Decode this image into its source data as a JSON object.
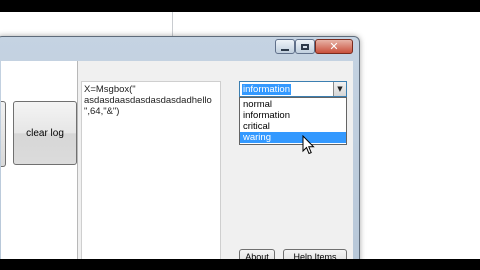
{
  "window": {
    "controls": {
      "minimize_icon": "minimize-icon",
      "maximize_icon": "maximize-icon",
      "close_icon": "close-icon",
      "close_glyph": "✕"
    }
  },
  "left_panel": {
    "clear_log_label": "clear log"
  },
  "code": {
    "text": "X=Msgbox(\"\nasdasdaasdasdasdasdadhello\n\",64,\"&\")"
  },
  "message_type": {
    "selected": "information",
    "options": [
      "normal",
      "information",
      "critical",
      "waring"
    ],
    "highlighted_option": "waring"
  },
  "buttons": {
    "about_label": "About",
    "help_label": "Help Items"
  },
  "colors": {
    "selection": "#3399ff",
    "close_button": "#c9503c",
    "frame": "#b7c7d8"
  }
}
